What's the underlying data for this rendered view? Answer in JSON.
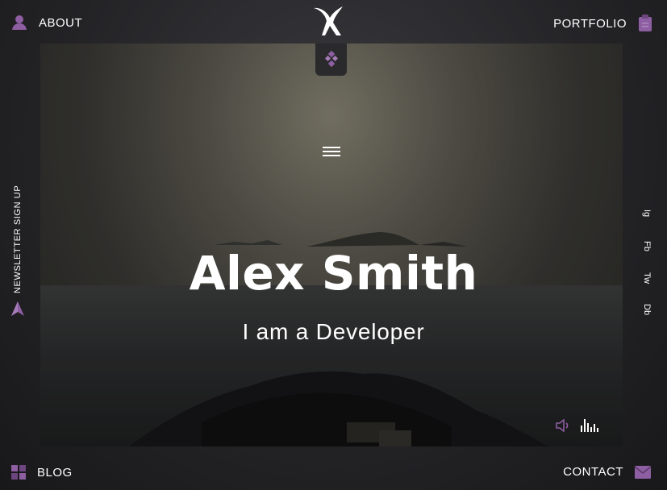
{
  "nav": {
    "about": "ABOUT",
    "portfolio": "PORTFOLIO",
    "blog": "BLOG",
    "contact": "CONTACT"
  },
  "hero": {
    "name": "Alex Smith",
    "tagline": "I am a Developer"
  },
  "newsletter": {
    "label": "NEWSLETTER SIGN UP"
  },
  "socials": [
    "Ig",
    "Fb",
    "Tw",
    "Db"
  ],
  "icons": {
    "about": "user-icon",
    "portfolio": "clipboard-icon",
    "blog": "grid-icon",
    "contact": "mail-icon",
    "newsletter": "paper-plane-icon",
    "logo": "bird-logo",
    "logo_tab": "diamond-dots-icon",
    "menu": "hamburger-icon",
    "volume": "volume-icon",
    "equalizer": "equalizer-icon"
  },
  "colors": {
    "accent": "#8e5ea2",
    "text": "#ffffff",
    "background": "#1c1c1f"
  }
}
